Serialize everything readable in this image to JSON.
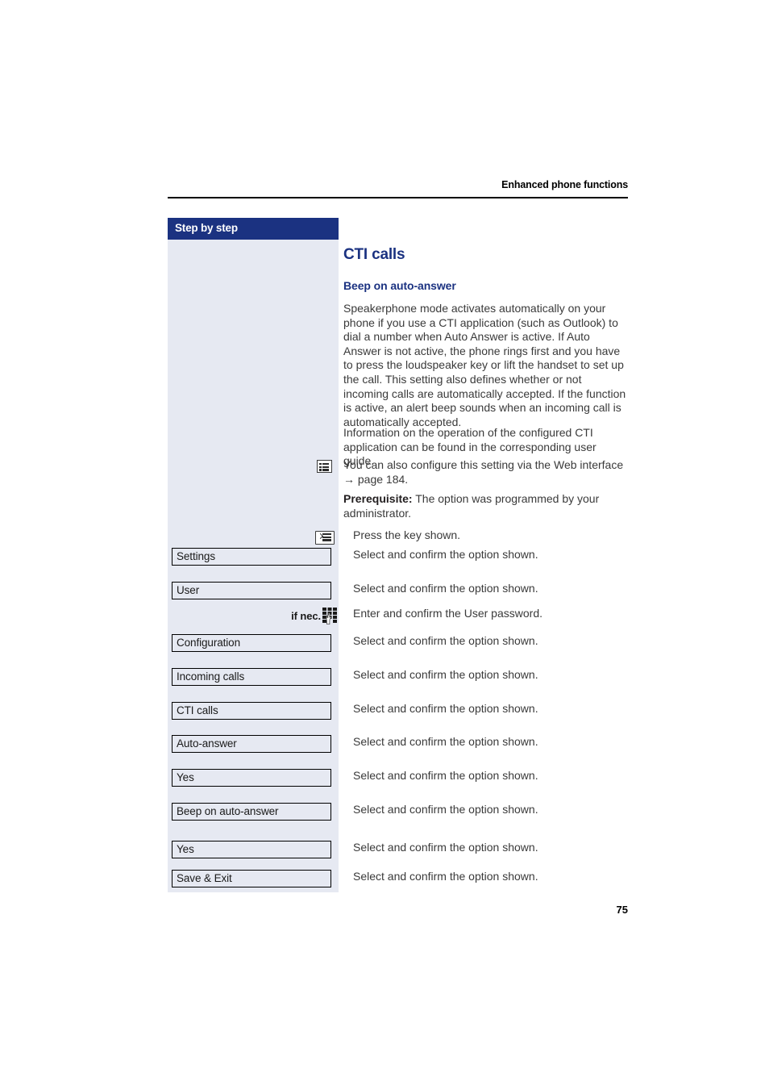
{
  "header": {
    "running_title": "Enhanced phone functions"
  },
  "sidebar": {
    "title": "Step by step"
  },
  "main": {
    "heading": "CTI calls",
    "subheading": "Beep on auto-answer",
    "paragraphs": [
      "Speakerphone mode activates automatically on your phone if you use a CTI application (such as Outlook) to dial a number when Auto Answer is active. If Auto Answer is not active, the phone rings first and you have to press the loudspeaker key or lift the handset to set up the call. This setting also defines whether or not incoming calls are automatically accepted. If the function is active, an alert beep sounds when an incoming call is automatically accepted.",
      "Information on the operation of the configured CTI application can be found in the corresponding user guide."
    ],
    "note": {
      "icon": "note-list-icon",
      "text": "You can also configure this setting via the Web interface → page 184."
    },
    "prerequisite": {
      "label": "Prerequisite:",
      "text": " The option was programmed by your administrator."
    }
  },
  "steps": [
    {
      "kind": "icon",
      "icon": "menu-key-icon",
      "instruction": "Press the key shown."
    },
    {
      "kind": "option",
      "option": "Settings",
      "instruction": "Select and confirm the option shown."
    },
    {
      "kind": "option",
      "option": "User",
      "instruction": "Select and confirm the option shown."
    },
    {
      "kind": "keypad",
      "prefix": "if nec.",
      "icon": "keypad-icon",
      "instruction": "Enter and confirm the User password."
    },
    {
      "kind": "option",
      "option": "Configuration",
      "instruction": "Select and confirm the option shown."
    },
    {
      "kind": "option",
      "option": "Incoming calls",
      "instruction": "Select and confirm the option shown."
    },
    {
      "kind": "option",
      "option": "CTI calls",
      "instruction": "Select and confirm the option shown."
    },
    {
      "kind": "option",
      "option": "Auto-answer",
      "instruction": "Select and confirm the option shown."
    },
    {
      "kind": "option",
      "option": "Yes",
      "instruction": "Select and confirm the option shown."
    },
    {
      "kind": "option",
      "option": "Beep on auto-answer",
      "instruction": "Select and confirm the option shown."
    },
    {
      "kind": "option",
      "option": "Yes",
      "instruction": "Select and confirm the option shown."
    },
    {
      "kind": "option",
      "option": "Save & Exit",
      "instruction": "Select and confirm the option shown."
    }
  ],
  "footer": {
    "page_number": "75"
  },
  "colors": {
    "brand_navy": "#1b3281",
    "sidebar_bg": "#e6e9f2",
    "body_text": "#3a3a3a"
  }
}
